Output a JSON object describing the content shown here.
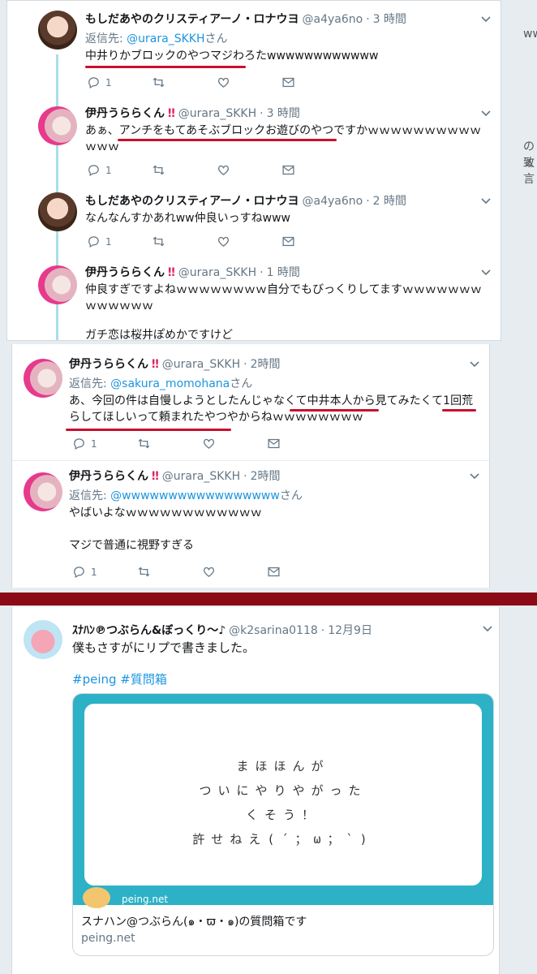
{
  "colors": {
    "link": "#1b95e0",
    "muted": "#657786",
    "annotation_red": "#c8102e",
    "divider": "#8a0a15"
  },
  "panel1": {
    "tweets": [
      {
        "name": "もしだあやのクリスティアーノ・ロナウヨ",
        "handle": "@a4ya6no",
        "time": "3 時間",
        "reply_prefix": "返信先: ",
        "reply_link": "@urara_SKKH",
        "reply_suffix": "さん",
        "text": "中井りかブロックのやつマジわろたwwwwwwwwwwww",
        "reply_count": "1"
      },
      {
        "name": "伊丹うららくん",
        "bang": "‼",
        "handle": "@urara_SKKH",
        "time": "3 時間",
        "text": "あぁ、アンチをもてあそぶブロックお遊びのやつですかｗｗｗｗｗｗｗｗｗｗｗｗｗ",
        "reply_count": "1"
      },
      {
        "name": "もしだあやのクリスティアーノ・ロナウヨ",
        "handle": "@a4ya6no",
        "time": "2 時間",
        "text": "なんなんすかあれww仲良いっすねwww",
        "reply_count": "1"
      },
      {
        "name": "伊丹うららくん",
        "bang": "‼",
        "handle": "@urara_SKKH",
        "time": "1 時間",
        "text": "仲良すぎですよねｗｗｗｗｗｗｗｗ自分でもびっくりしてますｗｗｗｗｗｗｗｗｗｗｗｗｗ",
        "text2": "ガチ恋は桜井ぽめかですけど"
      }
    ]
  },
  "bg_side_text": [
    "ww",
    "のぇ",
    "致言"
  ],
  "panel2": {
    "tweets": [
      {
        "name": "伊丹うららくん",
        "bang": "‼",
        "handle": "@urara_SKKH",
        "time": "2時間",
        "reply_prefix": "返信先: ",
        "reply_link": "@sakura_momohana",
        "reply_suffix": "さん",
        "text": "あ、今回の件は自慢しようとしたんじゃなくて中井本人から見てみたくて1回荒らしてほしいって頼まれたやつやからねｗｗｗｗｗｗｗｗ",
        "reply_count": "1"
      },
      {
        "name": "伊丹うららくん",
        "bang": "‼",
        "handle": "@urara_SKKH",
        "time": "2時間",
        "reply_prefix": "返信先: ",
        "reply_link": "@wwwwwwwwwwwwwwwww",
        "reply_suffix": "さん",
        "text": "やばいよなｗｗｗｗｗｗｗｗｗｗｗｗ",
        "text2": "マジで普通に視野すぎる",
        "reply_count": "1"
      }
    ]
  },
  "panel3": {
    "name": "ｽﾅﾊﾝ℗つぶらん&ぼっくり〜♪",
    "handle": "@k2sarina0118",
    "time": "12月9日",
    "text": "僕もさすがにリプで書きました。",
    "hashtags": "#peing #質問箱",
    "card": {
      "message_lines": [
        "まほほんが",
        "ついにやりやがった",
        "くそう！",
        "許せねえ(´；ω；`)"
      ],
      "logo_text": "peing.net",
      "title": "スナハン@つぶらん(๑・ϖ・๑)の質問箱です",
      "domain": "peing.net"
    }
  },
  "icons": [
    "reply-icon",
    "retweet-icon",
    "like-icon",
    "dm-icon",
    "chevron-down-icon"
  ]
}
